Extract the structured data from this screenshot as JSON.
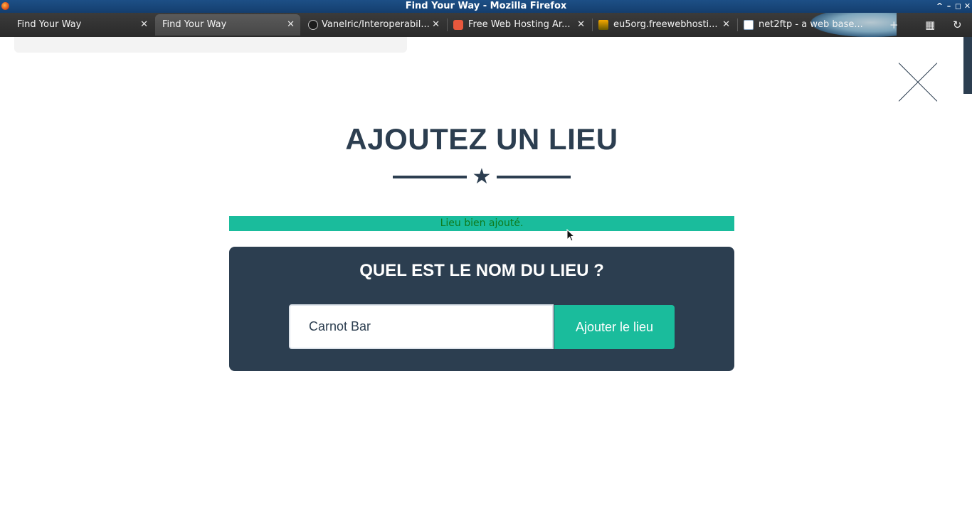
{
  "window": {
    "title": "Find Your Way - Mozilla Firefox",
    "controls": [
      "^",
      "–",
      "◻",
      "✕"
    ]
  },
  "tabs": [
    {
      "label": "Find Your Way",
      "active": false,
      "favicon": "none"
    },
    {
      "label": "Find Your Way",
      "active": true,
      "favicon": "none"
    },
    {
      "label": "Vanelric/Interoperabil...",
      "active": false,
      "favicon": "github-icon"
    },
    {
      "label": "Free Web Hosting Ar...",
      "active": false,
      "favicon": "hosting-icon"
    },
    {
      "label": "eu5org.freewebhosti...",
      "active": false,
      "favicon": "pma-icon"
    },
    {
      "label": "net2ftp - a web base...",
      "active": false,
      "favicon": "net2ftp-icon"
    }
  ],
  "toolbar": {
    "new_tab": "+",
    "tab_groups": "▦",
    "history": "↻"
  },
  "page": {
    "close_icon": "close-icon",
    "heading": "AJOUTEZ UN LIEU",
    "divider_icon": "star-icon",
    "divider_glyph": "★",
    "alert": "Lieu bien ajouté.",
    "form": {
      "title": "QUEL EST LE NOM DU LIEU ?",
      "input_value": "Carnot Bar",
      "submit_label": "Ajouter le lieu"
    }
  },
  "colors": {
    "primary_dark": "#2c3e50",
    "accent": "#1abc9c",
    "alert_text": "#0f7a1c"
  }
}
